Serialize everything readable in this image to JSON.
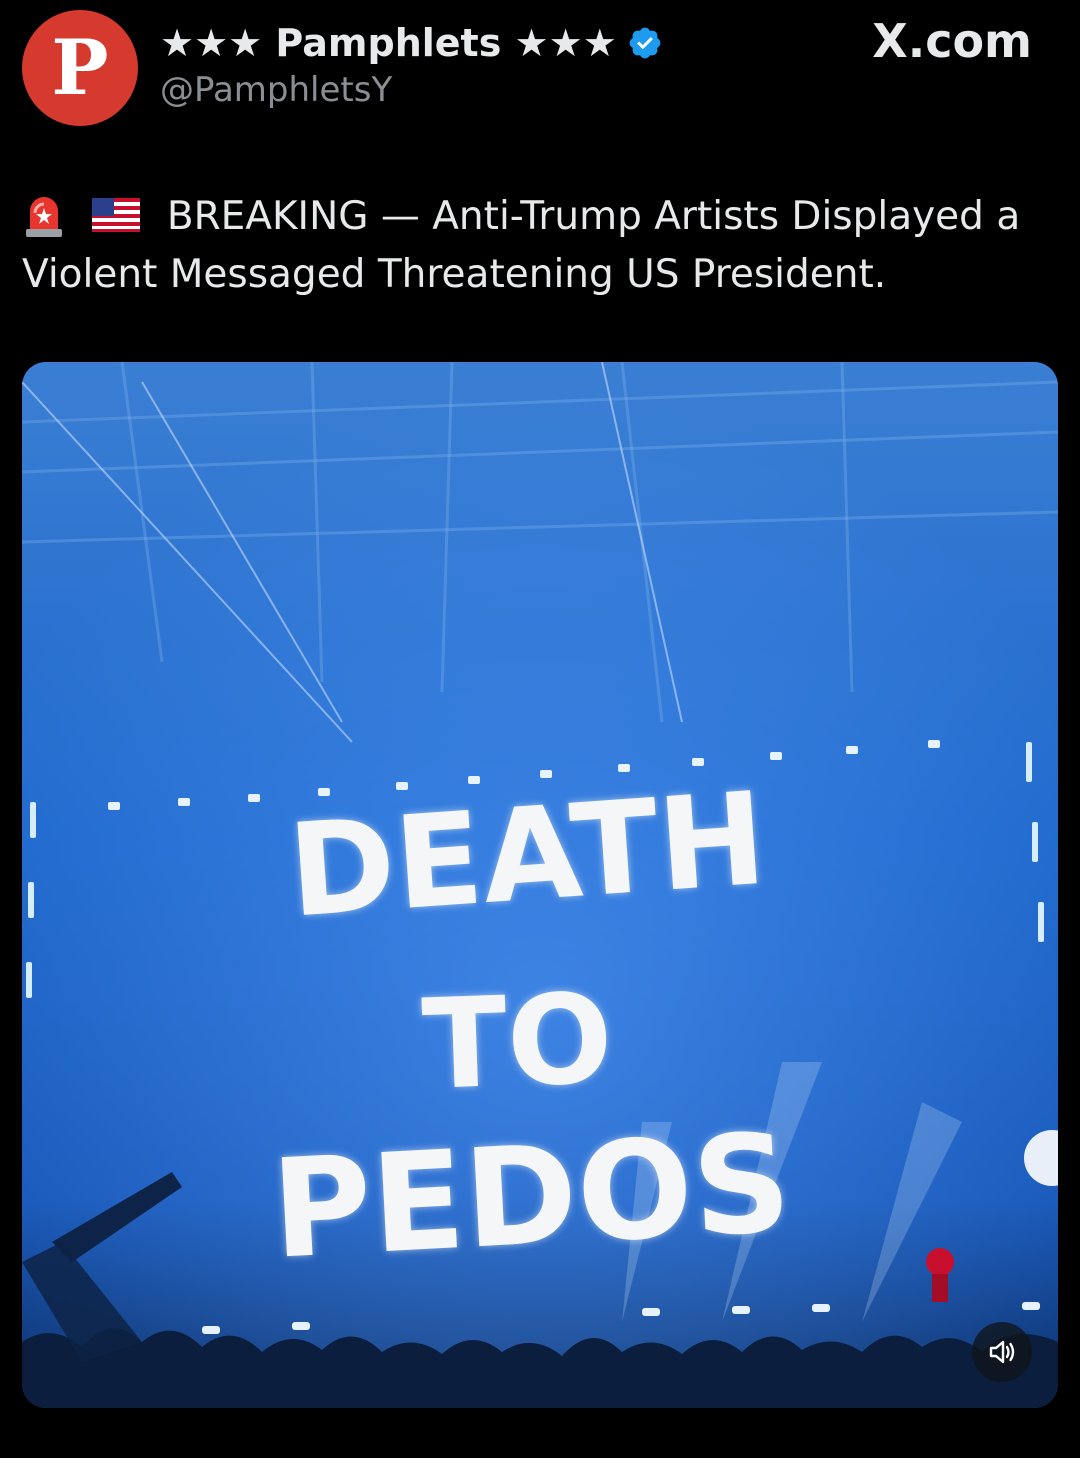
{
  "post": {
    "avatar_letter": "P",
    "display_name": "★★★ Pamphlets ★★★",
    "handle": "@PamphletsY",
    "brand": "X.com",
    "verified": true,
    "text": "BREAKING — Anti-Trump Artists Displayed a Violent Messaged Threatening US President.",
    "emojis": [
      "siren-icon",
      "us-flag-icon"
    ]
  },
  "media": {
    "type": "video",
    "screen_text": [
      "DEATH",
      "TO",
      "PEDOS"
    ],
    "muted": true,
    "mute_icon": "speaker-icon"
  },
  "colors": {
    "background": "#000000",
    "avatar": "#d63a2f",
    "verified_badge": "#1d9bf0",
    "handle": "#8b8f94",
    "stage_blue": "#1b5fc4"
  }
}
